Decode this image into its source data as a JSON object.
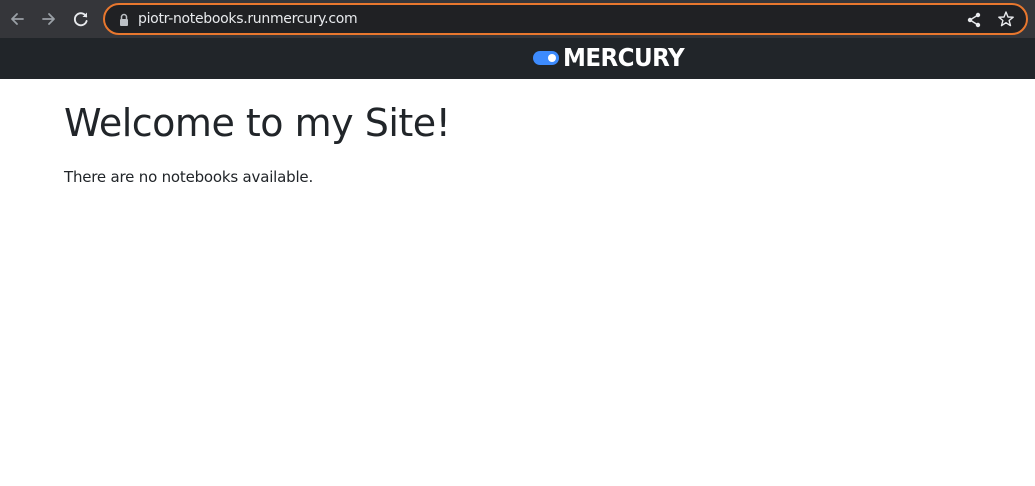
{
  "browser": {
    "url": "piotr-notebooks.runmercury.com",
    "icons": {
      "back": "arrow-left-icon",
      "forward": "arrow-right-icon",
      "reload": "reload-icon",
      "lock": "lock-icon",
      "share": "share-icon",
      "bookmark": "star-icon"
    },
    "colors": {
      "toolbar": "#35363a",
      "omnibox_border": "#e8772e",
      "omnibox_bg": "#202124"
    }
  },
  "header": {
    "logo_text": "MERCURY",
    "colors": {
      "background": "#212529",
      "toggle": "#3d8bfd"
    }
  },
  "main": {
    "title": "Welcome to my Site!",
    "message": "There are no notebooks available."
  }
}
